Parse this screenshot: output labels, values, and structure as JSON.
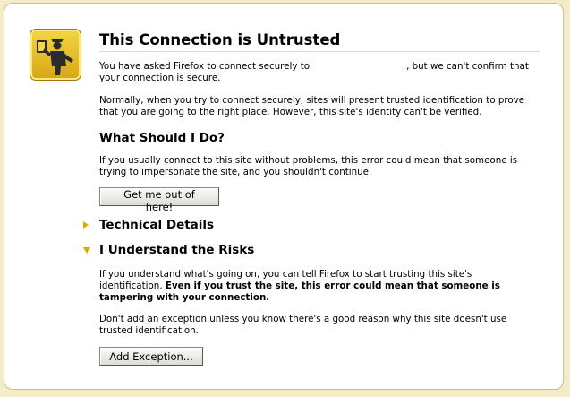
{
  "icon": "officer-stop-icon",
  "title": "This Connection is Untrusted",
  "intro": {
    "part1": "You have asked Firefox to connect securely to",
    "part2": ", but we can't confirm that your connection is secure."
  },
  "normally": "Normally, when you try to connect securely, sites will present trusted identification to prove that you are going to the right place. However, this site's identity can't be verified.",
  "what_should_heading": "What Should I Do?",
  "what_should_text": "If you usually connect to this site without problems, this error could mean that someone is trying to impersonate the site, and you shouldn't continue.",
  "get_me_out_button": "Get me out of here!",
  "technical_details": {
    "label": "Technical Details",
    "expanded": false
  },
  "understand_risks": {
    "label": "I Understand the Risks",
    "expanded": true,
    "text_part1": "If you understand what's going on, you can tell Firefox to start trusting this site's identification.",
    "text_bold": "Even if you trust the site, this error could mean that someone is tampering with your connection.",
    "text2": "Don't add an exception unless you know there's a good reason why this site doesn't use trusted identification.",
    "add_exception_button": "Add Exception..."
  },
  "colors": {
    "accent_triangle": "#e0a800",
    "icon_background": "#e3bd2a",
    "page_background": "#f3ecc8"
  }
}
